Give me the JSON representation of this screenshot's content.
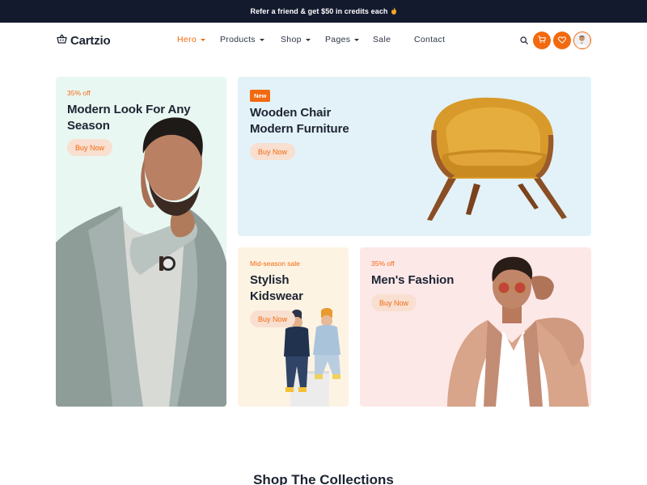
{
  "topbar": {
    "text": "Refer a friend & get $50 in credits each",
    "spark": "🔥"
  },
  "brand": {
    "name": "Cartzio",
    "accent_color": "#f26a10",
    "dark_color": "#141a2e"
  },
  "nav": {
    "items": [
      {
        "label": "Hero",
        "has_caret": true,
        "active": true
      },
      {
        "label": "Products",
        "has_caret": true,
        "active": false
      },
      {
        "label": "Shop",
        "has_caret": true,
        "active": false
      },
      {
        "label": "Pages",
        "has_caret": true,
        "active": false
      },
      {
        "label": "Sale",
        "has_caret": false,
        "active": false
      },
      {
        "label": "Contact",
        "has_caret": false,
        "active": false
      }
    ]
  },
  "header_icons": [
    "search-icon",
    "cart-icon",
    "heart-icon",
    "avatar"
  ],
  "hero_cards": [
    {
      "tag": "35% off",
      "title_line1": "Modern Look For Any",
      "title_line2": "Season",
      "button": "Buy Now",
      "background": "#e9f7f2"
    },
    {
      "badge": "New",
      "title_line1": "Wooden Chair",
      "title_line2": "Modern Furniture",
      "button": "Buy Now",
      "background": "#e3f2f8"
    },
    {
      "tag": "Mid-season sale",
      "title_line1": "Stylish",
      "title_line2": "Kidswear",
      "button": "Buy Now",
      "background": "#fdf3e3"
    },
    {
      "tag": "35% off",
      "title_line1": "Men's Fashion",
      "button": "Buy Now",
      "background": "#fde8e8"
    }
  ],
  "section": {
    "title": "Shop The Collections"
  }
}
